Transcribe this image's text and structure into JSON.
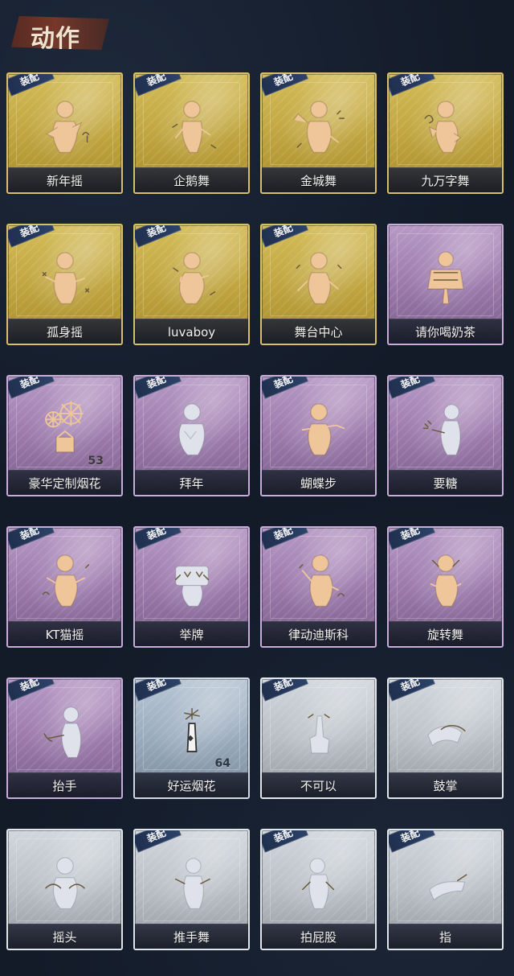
{
  "title": "动作",
  "colors": {
    "background": "#131b29",
    "title_banner": "#7a3929",
    "gold": "#c5aa45",
    "purple": "#9f7cae",
    "blue": "#9aabbd",
    "gray": "#b9bfc5",
    "badge": "#2c4268"
  },
  "badge_text": "装配",
  "items": [
    {
      "label": "新年摇",
      "count": "",
      "equipped": true,
      "rarity": "gold",
      "icon": "dance-icon"
    },
    {
      "label": "企鹅舞",
      "count": "",
      "equipped": true,
      "rarity": "gold",
      "icon": "dance-icon"
    },
    {
      "label": "金城舞",
      "count": "",
      "equipped": true,
      "rarity": "gold",
      "icon": "dance-icon"
    },
    {
      "label": "九万字舞",
      "count": "",
      "equipped": true,
      "rarity": "gold",
      "icon": "dance-icon"
    },
    {
      "label": "孤身摇",
      "count": "",
      "equipped": true,
      "rarity": "gold",
      "icon": "dance-icon"
    },
    {
      "label": "luvaboy",
      "count": "",
      "equipped": true,
      "rarity": "gold",
      "icon": "dance-icon"
    },
    {
      "label": "舞台中心",
      "count": "",
      "equipped": true,
      "rarity": "gold",
      "icon": "dance-icon"
    },
    {
      "label": "请你喝奶茶",
      "count": "",
      "equipped": false,
      "rarity": "purple",
      "icon": "gift-icon"
    },
    {
      "label": "豪华定制烟花",
      "count": "53",
      "equipped": true,
      "rarity": "purple",
      "icon": "fireworks-icon"
    },
    {
      "label": "拜年",
      "count": "",
      "equipped": true,
      "rarity": "purple",
      "icon": "bow-icon"
    },
    {
      "label": "蝴蝶步",
      "count": "",
      "equipped": true,
      "rarity": "purple",
      "icon": "dance-icon"
    },
    {
      "label": "要糖",
      "count": "",
      "equipped": true,
      "rarity": "purple",
      "icon": "candy-icon"
    },
    {
      "label": "KT猫摇",
      "count": "",
      "equipped": true,
      "rarity": "purple",
      "icon": "dance-icon"
    },
    {
      "label": "举牌",
      "count": "",
      "equipped": true,
      "rarity": "purple",
      "icon": "sign-icon"
    },
    {
      "label": "律动迪斯科",
      "count": "",
      "equipped": true,
      "rarity": "purple",
      "icon": "dance-icon"
    },
    {
      "label": "旋转舞",
      "count": "",
      "equipped": true,
      "rarity": "purple",
      "icon": "dance-icon"
    },
    {
      "label": "抬手",
      "count": "",
      "equipped": true,
      "rarity": "purple",
      "icon": "hand-icon"
    },
    {
      "label": "好运烟花",
      "count": "64",
      "equipped": true,
      "rarity": "blue",
      "icon": "firecracker-icon"
    },
    {
      "label": "不可以",
      "count": "",
      "equipped": true,
      "rarity": "gray",
      "icon": "finger-icon"
    },
    {
      "label": "鼓掌",
      "count": "",
      "equipped": true,
      "rarity": "gray",
      "icon": "clap-icon"
    },
    {
      "label": "摇头",
      "count": "",
      "equipped": false,
      "rarity": "gray",
      "icon": "headshake-icon"
    },
    {
      "label": "推手舞",
      "count": "",
      "equipped": true,
      "rarity": "gray",
      "icon": "push-dance-icon"
    },
    {
      "label": "拍屁股",
      "count": "",
      "equipped": true,
      "rarity": "gray",
      "icon": "slap-icon"
    },
    {
      "label": "指",
      "count": "",
      "equipped": true,
      "rarity": "gray",
      "icon": "point-icon"
    }
  ]
}
